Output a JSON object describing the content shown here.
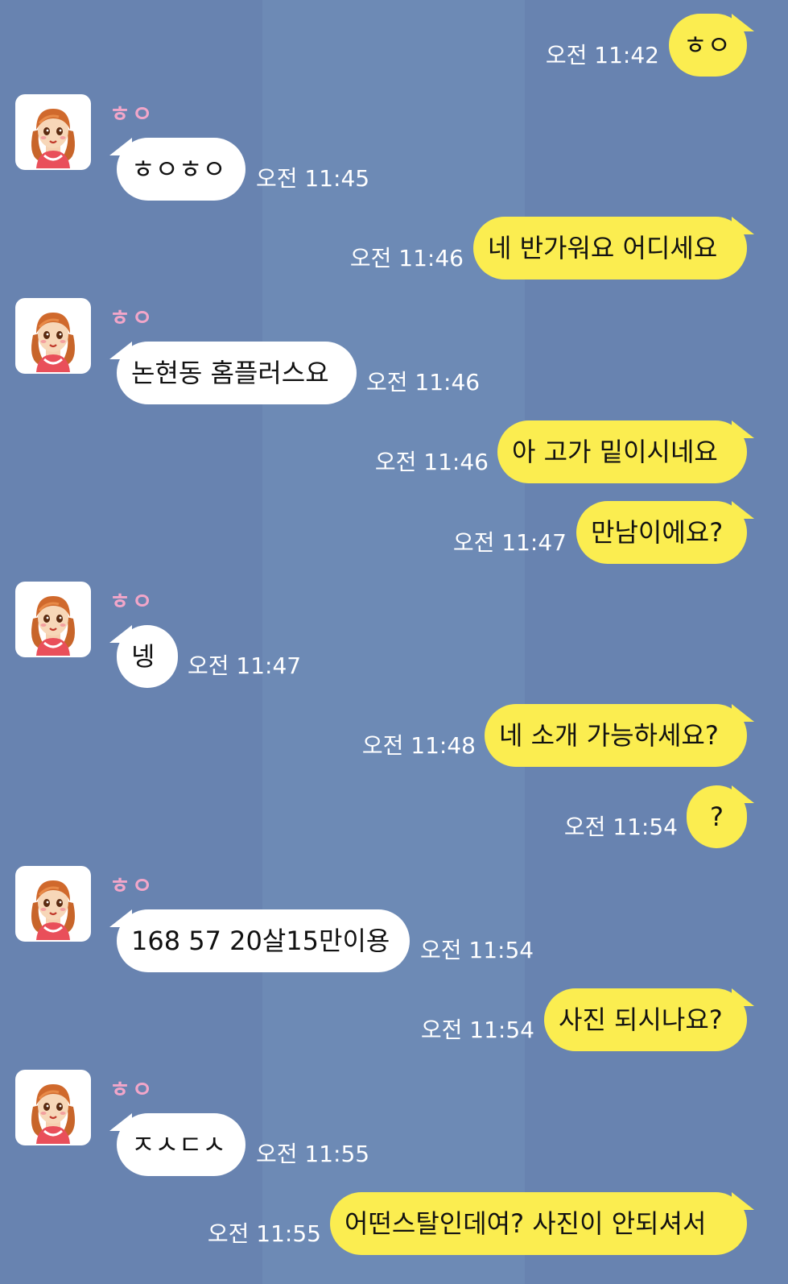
{
  "messages": [
    {
      "direction": "out",
      "text": "ㅎㅇ",
      "time": "오전 11:42"
    },
    {
      "direction": "in",
      "sender": "ㅎㅇ",
      "text": "ㅎㅇㅎㅇ",
      "time": "오전 11:45"
    },
    {
      "direction": "out",
      "text": "네 반가워요 어디세요",
      "time": "오전 11:46"
    },
    {
      "direction": "in",
      "sender": "ㅎㅇ",
      "text": "논현동 홈플러스요",
      "time": "오전 11:46"
    },
    {
      "direction": "out",
      "text": "아 고가 밑이시네요",
      "time": "오전 11:46"
    },
    {
      "direction": "out",
      "text": "만남이에요?",
      "time": "오전 11:47"
    },
    {
      "direction": "in",
      "sender": "ㅎㅇ",
      "text": "넹",
      "time": "오전 11:47"
    },
    {
      "direction": "out",
      "text": "네 소개 가능하세요?",
      "time": "오전 11:48"
    },
    {
      "direction": "out",
      "text": "?",
      "time": "오전 11:54"
    },
    {
      "direction": "in",
      "sender": "ㅎㅇ",
      "text": "168 57  20살15만이용",
      "time": "오전 11:54"
    },
    {
      "direction": "out",
      "text": "사진 되시나요?",
      "time": "오전 11:54"
    },
    {
      "direction": "in",
      "sender": "ㅎㅇ",
      "text": "ㅈㅅㄷㅅ",
      "time": "오전 11:55"
    },
    {
      "direction": "out",
      "text": "어떤스탈인데여? 사진이 안되셔서",
      "time": "오전 11:55"
    }
  ],
  "colors": {
    "background": "#6883b0",
    "outgoing_bubble": "#fbed50",
    "incoming_bubble": "#ffffff",
    "sender_name": "#f2a6c9",
    "timestamp": "#ffffff"
  },
  "icons": {
    "avatar": "cartoon-girl-avatar-icon"
  }
}
